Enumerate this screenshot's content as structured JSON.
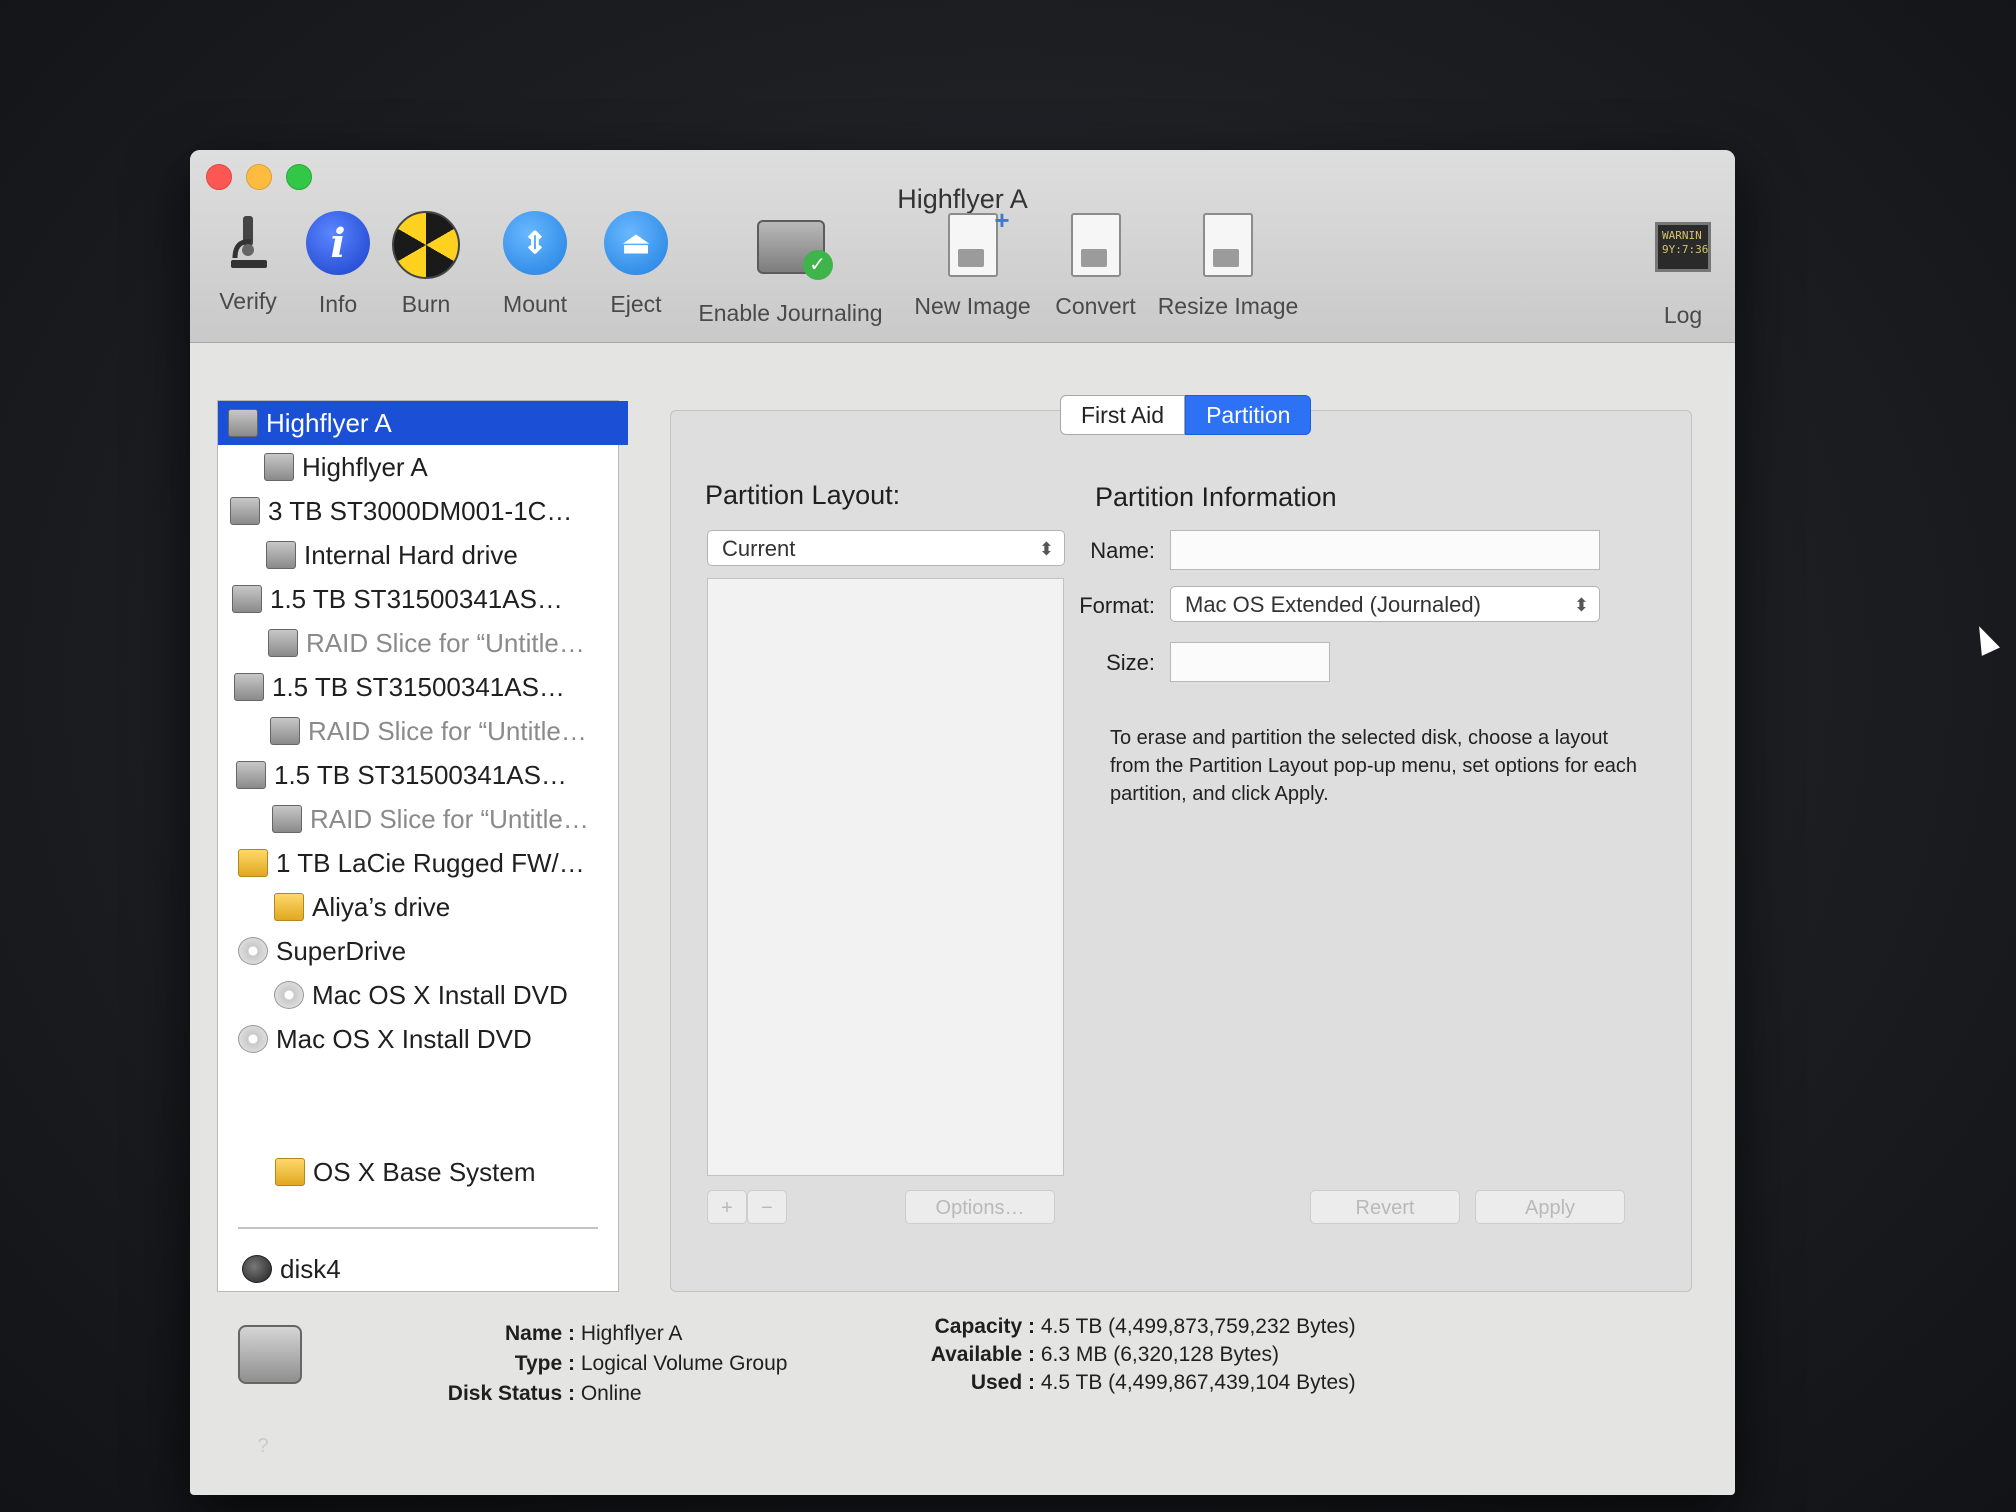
{
  "window": {
    "title": "Highflyer A"
  },
  "toolbar": {
    "verify": "Verify",
    "info": "Info",
    "burn": "Burn",
    "mount": "Mount",
    "eject": "Eject",
    "enable_journaling": "Enable Journaling",
    "new_image": "New Image",
    "convert": "Convert",
    "resize_image": "Resize Image",
    "log": "Log",
    "log_screen": "WARNIN\n9Y:7:36"
  },
  "sidebar": {
    "items": [
      {
        "label": "Highflyer A",
        "selected": true
      },
      {
        "label": "Highflyer A"
      },
      {
        "label": "3 TB ST3000DM001-1C…"
      },
      {
        "label": "Internal Hard drive"
      },
      {
        "label": "1.5 TB ST31500341AS…"
      },
      {
        "label": "RAID Slice for “Untitle…"
      },
      {
        "label": "1.5 TB ST31500341AS…"
      },
      {
        "label": "RAID Slice for “Untitle…"
      },
      {
        "label": "1.5 TB ST31500341AS…"
      },
      {
        "label": "RAID Slice for “Untitle…"
      },
      {
        "label": "1 TB LaCie Rugged FW/…"
      },
      {
        "label": "Aliya’s drive"
      },
      {
        "label": "SuperDrive"
      },
      {
        "label": "Mac OS X Install DVD"
      },
      {
        "label": "Mac OS X Install DVD"
      },
      {
        "label": "disk4"
      },
      {
        "label": "OS X Base System"
      }
    ]
  },
  "tabs": {
    "first_aid": "First Aid",
    "partition": "Partition"
  },
  "partition": {
    "layout_label": "Partition Layout:",
    "layout_value": "Current",
    "info_label": "Partition Information",
    "name_label": "Name:",
    "name_value": "",
    "format_label": "Format:",
    "format_value": "Mac OS Extended (Journaled)",
    "size_label": "Size:",
    "size_value": "",
    "help": "To erase and partition the selected disk, choose a layout from the Partition Layout pop-up menu, set options for each partition, and click Apply.",
    "add": "+",
    "remove": "−",
    "options": "Options…",
    "revert": "Revert",
    "apply": "Apply"
  },
  "details": {
    "name_k": "Name :",
    "name_v": "Highflyer A",
    "type_k": "Type :",
    "type_v": "Logical Volume Group",
    "status_k": "Disk Status :",
    "status_v": "Online",
    "capacity_k": "Capacity :",
    "capacity_v": "4.5 TB (4,499,873,759,232 Bytes)",
    "available_k": "Available :",
    "available_v": "6.3 MB (6,320,128 Bytes)",
    "used_k": "Used :",
    "used_v": "4.5 TB (4,499,867,439,104 Bytes)"
  },
  "help_button": "?"
}
